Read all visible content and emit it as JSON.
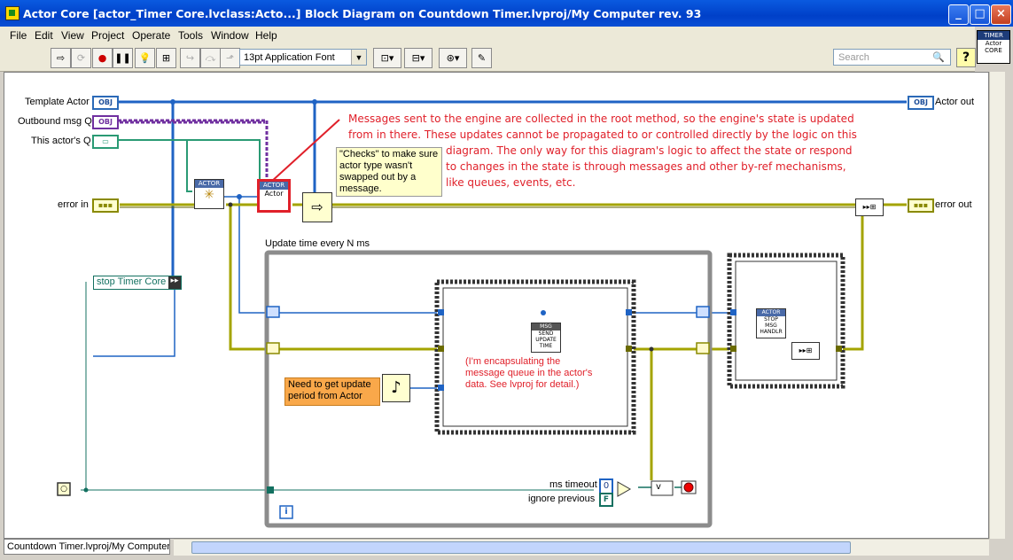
{
  "window": {
    "title": "Actor Core [actor_Timer Core.lvclass:Acto...] Block Diagram on Countdown Timer.lvproj/My Computer rev. 93",
    "buttons": [
      "_",
      "□",
      "×"
    ]
  },
  "menu": [
    "File",
    "Edit",
    "View",
    "Project",
    "Operate",
    "Tools",
    "Window",
    "Help"
  ],
  "toolbar": {
    "font_select": "13pt Application Font",
    "search_placeholder": "Search",
    "help": "?"
  },
  "vi_icon": {
    "header": "TIMER",
    "lines": [
      "Actor",
      "CORE"
    ]
  },
  "diagram": {
    "terminals": {
      "template_actor": "Template Actor",
      "outbound_msg_q": "Outbound msg Q",
      "this_actors_q": "This actor's Q",
      "error_in": "error in",
      "actor_out": "Actor out",
      "error_out": "error out",
      "stop_timer_core": "stop Timer Core",
      "ms_timeout": "ms timeout",
      "ignore_previous": "ignore previous",
      "ms_timeout_value": "0",
      "ignore_previous_value": "F"
    },
    "obj_tag": "OBJ",
    "comments": {
      "engine": [
        "Messages sent to the engine are collected in the root method, so the engine's state is updated",
        "from in there. These updates cannot be propagated to or controlled directly by the logic on this",
        "diagram. The only way for this diagram's logic to affect the state or respond",
        "to changes in the state is through messages and other by-ref mechanisms,",
        "like queues, events, etc."
      ],
      "checks": [
        "\"Checks\" to make sure",
        "actor type wasn't",
        "swapped out by a",
        "message."
      ],
      "need_period": [
        "Need to get update",
        "period from Actor"
      ],
      "encapsulating": [
        "(I'm encapsulating the",
        "message queue in the actor's",
        "data. See lvproj for detail.)"
      ]
    },
    "loop_label": "Update time every N ms",
    "nodes": {
      "actor_header": "ACTOR",
      "actor_core_call": "Actor",
      "send_msg_header": "MSG",
      "send_msg_lines": [
        "SEND",
        "UPDATE",
        "TIME"
      ],
      "stop_msg_header": "ACTOR",
      "stop_msg_lines": [
        "STOP",
        "MSG",
        "HANDLR"
      ],
      "loop_iter": "i"
    }
  },
  "status": {
    "context": "Countdown Timer.lvproj/My Computer"
  },
  "colors": {
    "title_bar": "#0a4fd4",
    "comment_red": "#e0202a",
    "wire_blue": "#1f63c4",
    "wire_yellow": "#8a8a00",
    "note_orange": "#f9a84a",
    "note_yellow": "#ffffcc"
  }
}
